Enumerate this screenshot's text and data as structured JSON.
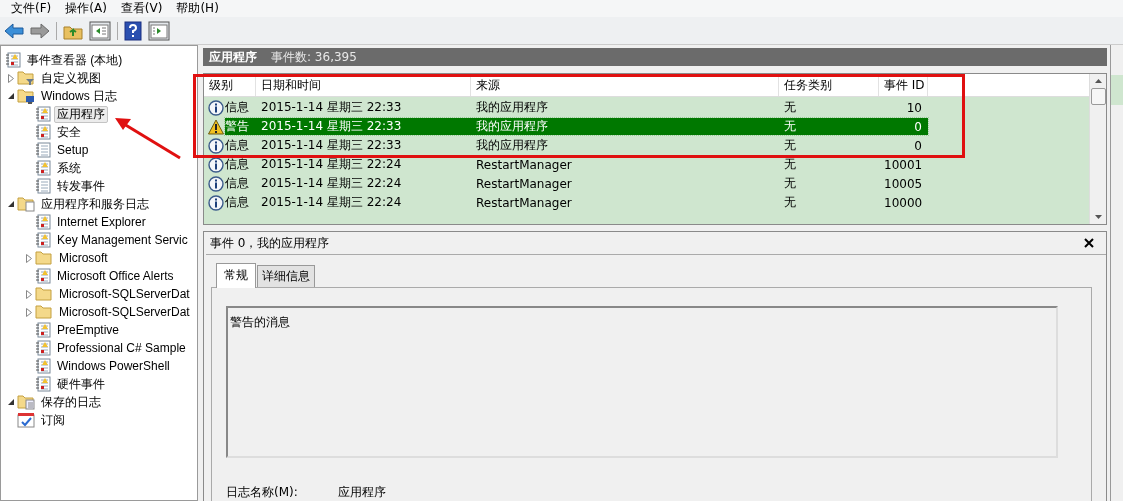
{
  "menu": [
    "文件(F)",
    "操作(A)",
    "查看(V)",
    "帮助(H)"
  ],
  "tree": [
    {
      "label": "事件查看器 (本地)",
      "kind": "root",
      "selected": false,
      "children": [
        {
          "label": "自定义视图",
          "kind": "filter-folder",
          "expanded": false,
          "selected": false
        },
        {
          "label": "Windows 日志",
          "kind": "windows-folder",
          "expanded": true,
          "selected": false,
          "children": [
            {
              "label": "应用程序",
              "kind": "log",
              "selected": true
            },
            {
              "label": "安全",
              "kind": "log",
              "selected": false
            },
            {
              "label": "Setup",
              "kind": "plain-log",
              "selected": false
            },
            {
              "label": "系统",
              "kind": "log",
              "selected": false
            },
            {
              "label": "转发事件",
              "kind": "plain-log",
              "selected": false
            }
          ]
        },
        {
          "label": "应用程序和服务日志",
          "kind": "doc-folder",
          "expanded": true,
          "selected": false,
          "children": [
            {
              "label": "Internet Explorer",
              "kind": "log",
              "selected": false
            },
            {
              "label": "Key Management Servic",
              "kind": "log",
              "selected": false
            },
            {
              "label": "Microsoft",
              "kind": "folder",
              "expanded": false,
              "selected": false
            },
            {
              "label": "Microsoft Office Alerts",
              "kind": "log",
              "selected": false
            },
            {
              "label": "Microsoft-SQLServerDat",
              "kind": "folder",
              "expanded": false,
              "selected": false
            },
            {
              "label": "Microsoft-SQLServerDat",
              "kind": "folder",
              "expanded": false,
              "selected": false
            },
            {
              "label": "PreEmptive",
              "kind": "log",
              "selected": false
            },
            {
              "label": "Professional C# Sample",
              "kind": "log",
              "selected": false
            },
            {
              "label": "Windows PowerShell",
              "kind": "log",
              "selected": false
            },
            {
              "label": "硬件事件",
              "kind": "log",
              "selected": false
            }
          ]
        },
        {
          "label": "保存的日志",
          "kind": "saved-folder",
          "expanded": true,
          "selected": false
        },
        {
          "label": "订阅",
          "kind": "subscription",
          "selected": false
        }
      ]
    }
  ],
  "log_header": {
    "name": "应用程序",
    "count": "事件数: 36,395"
  },
  "table": {
    "columns": [
      "级别",
      "日期和时间",
      "来源",
      "任务类别",
      "事件 ID"
    ],
    "rows": [
      {
        "kind": "info",
        "level": "信息",
        "date": "2015-1-14 星期三 22:33",
        "source": "我的应用程序",
        "task": "无",
        "id": "10",
        "selected": false
      },
      {
        "kind": "warning",
        "level": "警告",
        "date": "2015-1-14 星期三 22:33",
        "source": "我的应用程序",
        "task": "无",
        "id": "0",
        "selected": true
      },
      {
        "kind": "info",
        "level": "信息",
        "date": "2015-1-14 星期三 22:33",
        "source": "我的应用程序",
        "task": "无",
        "id": "0",
        "selected": false
      },
      {
        "kind": "info",
        "level": "信息",
        "date": "2015-1-14 星期三 22:24",
        "source": "RestartManager",
        "task": "无",
        "id": "10001",
        "selected": false
      },
      {
        "kind": "info",
        "level": "信息",
        "date": "2015-1-14 星期三 22:24",
        "source": "RestartManager",
        "task": "无",
        "id": "10005",
        "selected": false
      },
      {
        "kind": "info",
        "level": "信息",
        "date": "2015-1-14 星期三 22:24",
        "source": "RestartManager",
        "task": "无",
        "id": "10000",
        "selected": false
      }
    ]
  },
  "detail": {
    "title": "事件 0，我的应用程序",
    "tabs": [
      {
        "label": "常规",
        "selected": true
      },
      {
        "label": "详细信息",
        "selected": false
      }
    ],
    "message": "警告的消息",
    "fields": [
      {
        "label": "日志名称(M):",
        "value": "应用程序"
      }
    ]
  }
}
